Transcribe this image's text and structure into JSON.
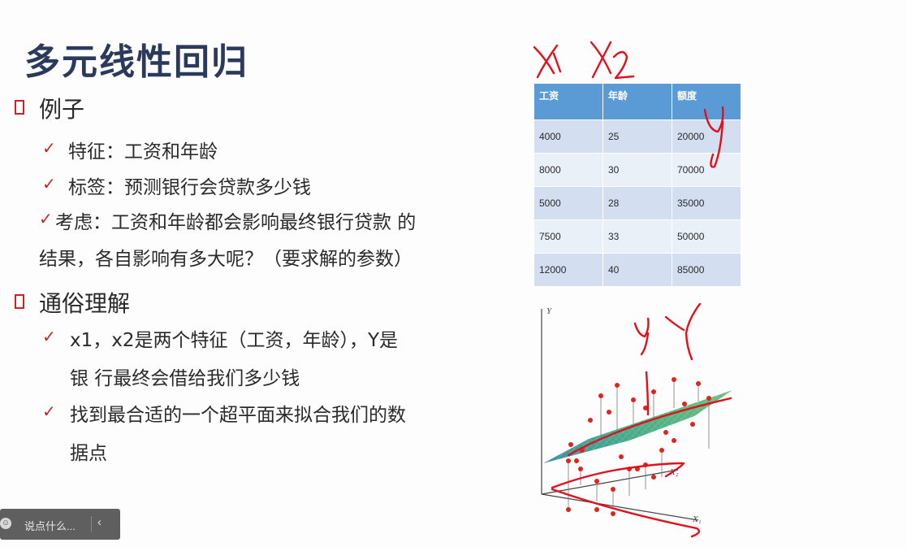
{
  "title": "多元线性回归",
  "section1": {
    "heading": "例子",
    "items": [
      "特征：工资和年龄",
      "标签：预测银行会贷款多少钱",
      "考虑：工资和年龄都会影响最终银行贷款 的",
      "结果，各自影响有多大呢？（要求解的参数）"
    ]
  },
  "section2": {
    "heading": "通俗理解",
    "items": [
      "x1，x2是两个特征（工资，年龄），Y是",
      "银 行最终会借给我们多少钱",
      "找到最合适的一个超平面来拟合我们的数",
      "据点"
    ]
  },
  "table": {
    "headers": [
      "工资",
      "年龄",
      "额度"
    ],
    "rows": [
      [
        "4000",
        "25",
        "20000"
      ],
      [
        "8000",
        "30",
        "70000"
      ],
      [
        "5000",
        "28",
        "35000"
      ],
      [
        "7500",
        "33",
        "50000"
      ],
      [
        "12000",
        "40",
        "85000"
      ]
    ]
  },
  "plot": {
    "axis_y": "Y",
    "axis_x1": "X₁",
    "axis_x2": "X₂"
  },
  "comment_bar": {
    "placeholder": "说点什么...",
    "collapse_icon": "chevron-left-icon",
    "emoji_icon": "emoji-icon"
  },
  "colors": {
    "title": "#2b3a5c",
    "accent_red": "#c0272d",
    "table_header": "#5b9bd5",
    "ink_red": "#e0101c"
  }
}
